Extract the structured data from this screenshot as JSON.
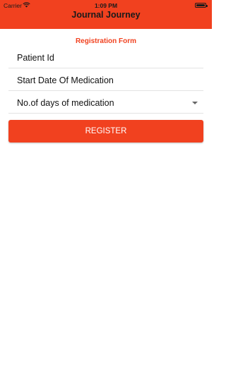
{
  "status_bar": {
    "carrier": "Carrier",
    "time": "1:09 PM"
  },
  "header": {
    "title": "Journal Journey"
  },
  "form": {
    "title": "Registration Form",
    "fields": [
      {
        "label": "Patient Id"
      },
      {
        "label": "Start Date Of Medication"
      },
      {
        "label": "No.of days of medication"
      }
    ],
    "register_label": "REGISTER"
  },
  "colors": {
    "accent": "#f1411f",
    "text": "#111111",
    "divider": "#e3e3e3"
  }
}
